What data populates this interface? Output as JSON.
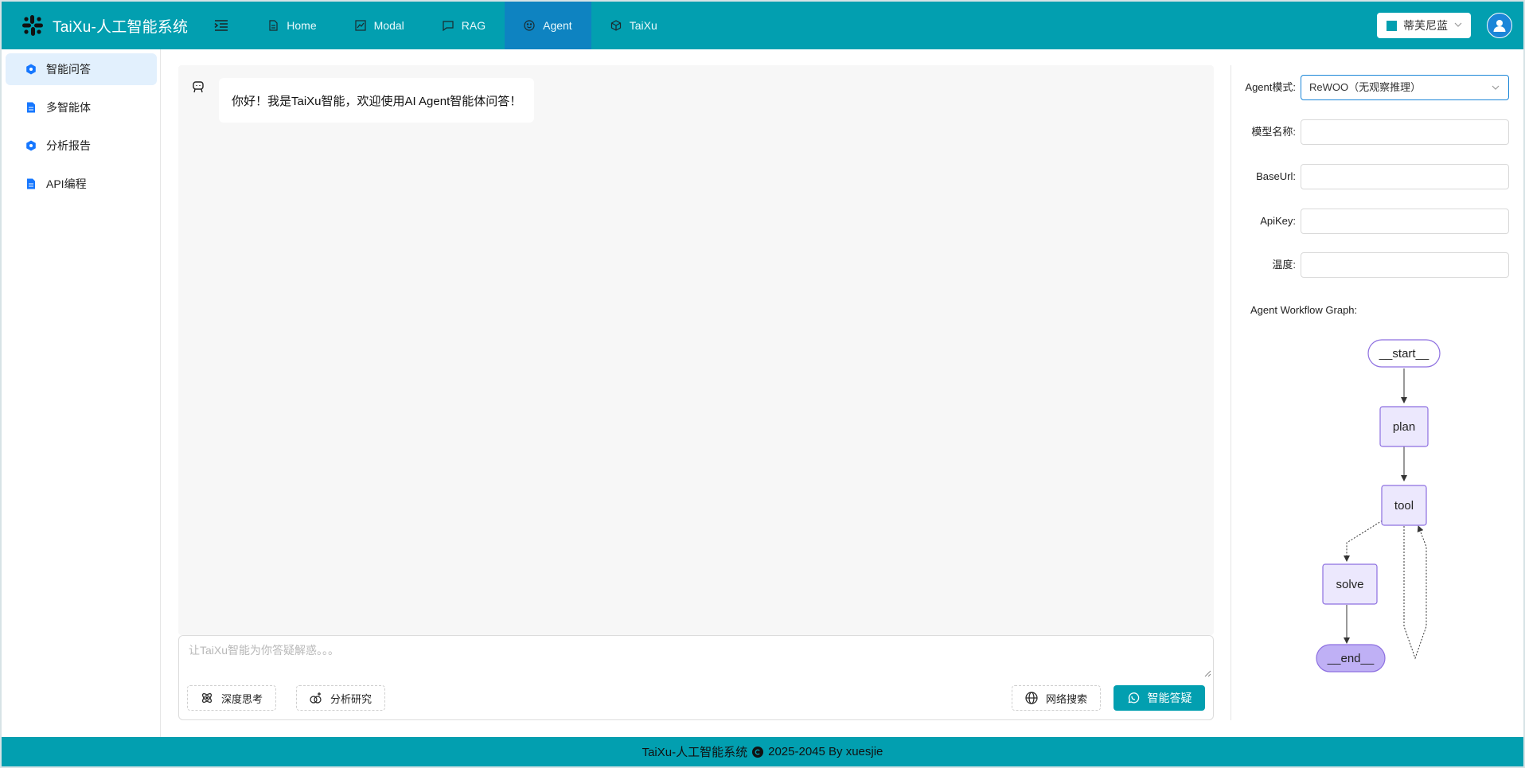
{
  "app": {
    "title": "TaiXu-人工智能系统"
  },
  "nav": [
    {
      "label": "Home",
      "icon": "document-icon",
      "active": false
    },
    {
      "label": "Modal",
      "icon": "chart-icon",
      "active": false
    },
    {
      "label": "RAG",
      "icon": "chat-flag-icon",
      "active": false
    },
    {
      "label": "Agent",
      "icon": "smile-icon",
      "active": true
    },
    {
      "label": "TaiXu",
      "icon": "cube-icon",
      "active": false
    }
  ],
  "theme": {
    "label": "蒂芙尼蓝",
    "color": "#029fb0"
  },
  "sidebar": {
    "items": [
      {
        "label": "智能问答",
        "icon": "hexagon-icon",
        "active": true
      },
      {
        "label": "多智能体",
        "icon": "file-icon",
        "active": false
      },
      {
        "label": "分析报告",
        "icon": "hexagon-icon",
        "active": false
      },
      {
        "label": "API编程",
        "icon": "file-icon",
        "active": false
      }
    ]
  },
  "chat": {
    "welcome": "你好！我是TaiXu智能，欢迎使用AI Agent智能体问答！",
    "placeholder": "让TaiXu智能为你答疑解惑。。。",
    "deep_think": "深度思考",
    "analysis": "分析研究",
    "web_search": "网络搜索",
    "submit": "智能答疑"
  },
  "settings": {
    "agent_mode_label": "Agent模式:",
    "agent_mode_value": "ReWOO（无观察推理）",
    "model_name_label": "模型名称:",
    "model_name_value": "",
    "base_url_label": "BaseUrl:",
    "base_url_value": "",
    "api_key_label": "ApiKey:",
    "api_key_value": "",
    "temperature_label": "温度:",
    "temperature_value": ""
  },
  "graph": {
    "title": "Agent Workflow Graph:",
    "nodes": {
      "start": "__start__",
      "plan": "plan",
      "tool": "tool",
      "solve": "solve",
      "end": "__end__"
    }
  },
  "footer": {
    "prefix": "TaiXu-人工智能系统",
    "suffix": "2025-2045 By xuesjie"
  },
  "colors": {
    "primary": "#029fb0",
    "nav_active": "#0e83c1",
    "sidebar_active": "#e2f0fd",
    "graph_node_fill": "#ece8fd",
    "graph_node_border": "#8d6fe0",
    "graph_end_fill": "#bfb0f5"
  }
}
